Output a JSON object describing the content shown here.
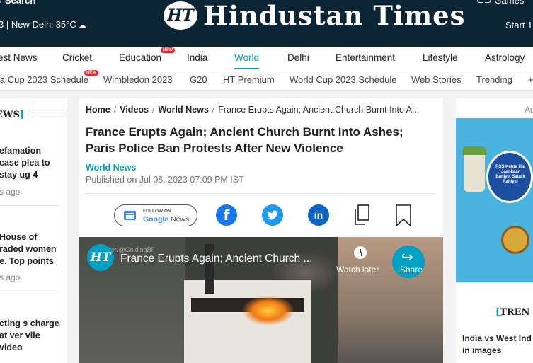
{
  "header": {
    "search_label": "Search",
    "games_label": "Games",
    "left_info": "3 | New Delhi 35",
    "temp_unit": "°C",
    "logo_mark": "HT",
    "logo_text": "Hindustan Times",
    "start_label": "Start 1"
  },
  "nav": {
    "items": [
      {
        "label": "est News"
      },
      {
        "label": "Cricket"
      },
      {
        "label": "Education",
        "badge": "NEW"
      },
      {
        "label": "India"
      },
      {
        "label": "World",
        "active": true
      },
      {
        "label": "Delhi"
      },
      {
        "label": "Entertainment"
      },
      {
        "label": "Lifestyle"
      },
      {
        "label": "Astrology"
      }
    ]
  },
  "subnav": {
    "items": [
      {
        "label": "ia Cup 2023 Schedule",
        "badge": "NEW"
      },
      {
        "label": "Wimbledon 2023"
      },
      {
        "label": "G20"
      },
      {
        "label": "HT Premium"
      },
      {
        "label": "World Cup 2023 Schedule"
      },
      {
        "label": "Web Stories"
      },
      {
        "label": "Trending"
      },
      {
        "label": "+"
      }
    ]
  },
  "left_sidebar": {
    "heading": "EWS",
    "bracket": "]",
    "stories": [
      {
        "title": "efamation case plea to stay ug 4",
        "time": "s ago"
      },
      {
        "title": "House of raded women e. Top points",
        "time": "s ago"
      },
      {
        "title": "cting s charge at ver vile video",
        "time": ""
      }
    ]
  },
  "main": {
    "breadcrumb": [
      "Home",
      "Videos",
      "World News"
    ],
    "breadcrumb_current": "France Erupts Again; Ancient Church Burnt Into A...",
    "title": "France Erupts Again; Ancient Church Burnt Into Ashes; Paris Police Ban Protests After New Violence",
    "category": "World News",
    "published": "Published on Jul 08, 2023 07:09 PM IST",
    "google_news_top": "FOLLOW ON",
    "google_news_g": "Google",
    "google_news_n": " News"
  },
  "video": {
    "logo": "HT",
    "handle": "tter/@GoldingBF",
    "title": "France Erupts Again; Ancient Church ...",
    "watch_later": "Watch later",
    "share": "Share"
  },
  "right_sidebar": {
    "ad_label": "Ad",
    "ad_badge_text": "RSS Kehta Hai Jaankaar Baniye, Satark Rahiye!",
    "trending_heading": "TREN",
    "trending_bracket": "[",
    "trending_story": "India vs West Ind in images"
  },
  "colors": {
    "header_bg": "#0b2536",
    "accent": "#00a0c4",
    "badge_red": "#e8252a",
    "facebook": "#1877f2",
    "twitter": "#1d9bf0",
    "linkedin": "#0a66c2"
  }
}
